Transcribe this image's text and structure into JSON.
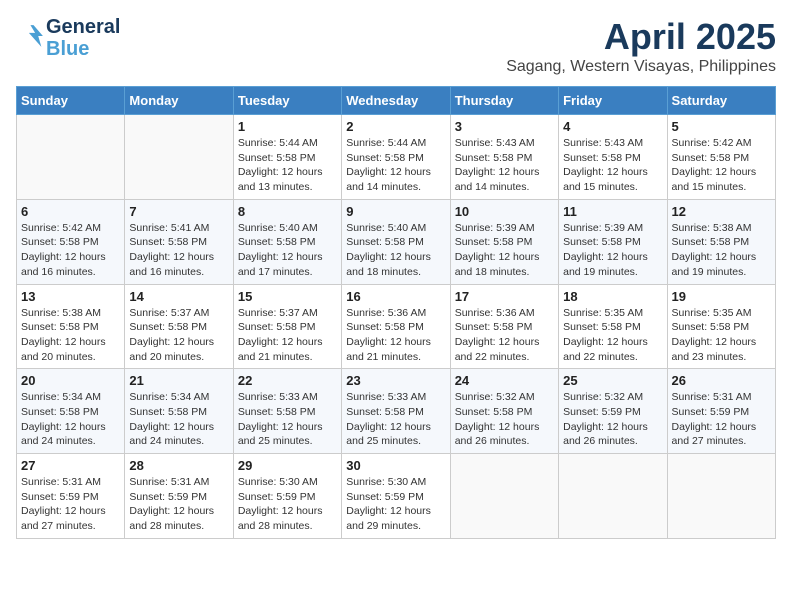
{
  "header": {
    "logo_line1": "General",
    "logo_line2": "Blue",
    "title": "April 2025",
    "subtitle": "Sagang, Western Visayas, Philippines"
  },
  "calendar": {
    "columns": [
      "Sunday",
      "Monday",
      "Tuesday",
      "Wednesday",
      "Thursday",
      "Friday",
      "Saturday"
    ],
    "weeks": [
      [
        {
          "day": "",
          "info": ""
        },
        {
          "day": "",
          "info": ""
        },
        {
          "day": "1",
          "info": "Sunrise: 5:44 AM\nSunset: 5:58 PM\nDaylight: 12 hours\nand 13 minutes."
        },
        {
          "day": "2",
          "info": "Sunrise: 5:44 AM\nSunset: 5:58 PM\nDaylight: 12 hours\nand 14 minutes."
        },
        {
          "day": "3",
          "info": "Sunrise: 5:43 AM\nSunset: 5:58 PM\nDaylight: 12 hours\nand 14 minutes."
        },
        {
          "day": "4",
          "info": "Sunrise: 5:43 AM\nSunset: 5:58 PM\nDaylight: 12 hours\nand 15 minutes."
        },
        {
          "day": "5",
          "info": "Sunrise: 5:42 AM\nSunset: 5:58 PM\nDaylight: 12 hours\nand 15 minutes."
        }
      ],
      [
        {
          "day": "6",
          "info": "Sunrise: 5:42 AM\nSunset: 5:58 PM\nDaylight: 12 hours\nand 16 minutes."
        },
        {
          "day": "7",
          "info": "Sunrise: 5:41 AM\nSunset: 5:58 PM\nDaylight: 12 hours\nand 16 minutes."
        },
        {
          "day": "8",
          "info": "Sunrise: 5:40 AM\nSunset: 5:58 PM\nDaylight: 12 hours\nand 17 minutes."
        },
        {
          "day": "9",
          "info": "Sunrise: 5:40 AM\nSunset: 5:58 PM\nDaylight: 12 hours\nand 18 minutes."
        },
        {
          "day": "10",
          "info": "Sunrise: 5:39 AM\nSunset: 5:58 PM\nDaylight: 12 hours\nand 18 minutes."
        },
        {
          "day": "11",
          "info": "Sunrise: 5:39 AM\nSunset: 5:58 PM\nDaylight: 12 hours\nand 19 minutes."
        },
        {
          "day": "12",
          "info": "Sunrise: 5:38 AM\nSunset: 5:58 PM\nDaylight: 12 hours\nand 19 minutes."
        }
      ],
      [
        {
          "day": "13",
          "info": "Sunrise: 5:38 AM\nSunset: 5:58 PM\nDaylight: 12 hours\nand 20 minutes."
        },
        {
          "day": "14",
          "info": "Sunrise: 5:37 AM\nSunset: 5:58 PM\nDaylight: 12 hours\nand 20 minutes."
        },
        {
          "day": "15",
          "info": "Sunrise: 5:37 AM\nSunset: 5:58 PM\nDaylight: 12 hours\nand 21 minutes."
        },
        {
          "day": "16",
          "info": "Sunrise: 5:36 AM\nSunset: 5:58 PM\nDaylight: 12 hours\nand 21 minutes."
        },
        {
          "day": "17",
          "info": "Sunrise: 5:36 AM\nSunset: 5:58 PM\nDaylight: 12 hours\nand 22 minutes."
        },
        {
          "day": "18",
          "info": "Sunrise: 5:35 AM\nSunset: 5:58 PM\nDaylight: 12 hours\nand 22 minutes."
        },
        {
          "day": "19",
          "info": "Sunrise: 5:35 AM\nSunset: 5:58 PM\nDaylight: 12 hours\nand 23 minutes."
        }
      ],
      [
        {
          "day": "20",
          "info": "Sunrise: 5:34 AM\nSunset: 5:58 PM\nDaylight: 12 hours\nand 24 minutes."
        },
        {
          "day": "21",
          "info": "Sunrise: 5:34 AM\nSunset: 5:58 PM\nDaylight: 12 hours\nand 24 minutes."
        },
        {
          "day": "22",
          "info": "Sunrise: 5:33 AM\nSunset: 5:58 PM\nDaylight: 12 hours\nand 25 minutes."
        },
        {
          "day": "23",
          "info": "Sunrise: 5:33 AM\nSunset: 5:58 PM\nDaylight: 12 hours\nand 25 minutes."
        },
        {
          "day": "24",
          "info": "Sunrise: 5:32 AM\nSunset: 5:58 PM\nDaylight: 12 hours\nand 26 minutes."
        },
        {
          "day": "25",
          "info": "Sunrise: 5:32 AM\nSunset: 5:59 PM\nDaylight: 12 hours\nand 26 minutes."
        },
        {
          "day": "26",
          "info": "Sunrise: 5:31 AM\nSunset: 5:59 PM\nDaylight: 12 hours\nand 27 minutes."
        }
      ],
      [
        {
          "day": "27",
          "info": "Sunrise: 5:31 AM\nSunset: 5:59 PM\nDaylight: 12 hours\nand 27 minutes."
        },
        {
          "day": "28",
          "info": "Sunrise: 5:31 AM\nSunset: 5:59 PM\nDaylight: 12 hours\nand 28 minutes."
        },
        {
          "day": "29",
          "info": "Sunrise: 5:30 AM\nSunset: 5:59 PM\nDaylight: 12 hours\nand 28 minutes."
        },
        {
          "day": "30",
          "info": "Sunrise: 5:30 AM\nSunset: 5:59 PM\nDaylight: 12 hours\nand 29 minutes."
        },
        {
          "day": "",
          "info": ""
        },
        {
          "day": "",
          "info": ""
        },
        {
          "day": "",
          "info": ""
        }
      ]
    ]
  }
}
